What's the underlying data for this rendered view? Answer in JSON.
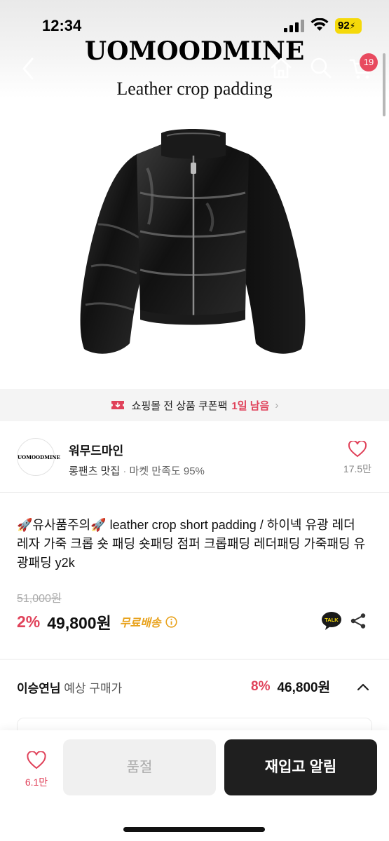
{
  "status_bar": {
    "time": "12:34",
    "battery": "92"
  },
  "brand": {
    "logo_text": "UOMOODMINE",
    "product_subtitle": "Leather crop padding"
  },
  "cart": {
    "badge_count": "19"
  },
  "icons": {
    "back": "chevron-left-icon",
    "home": "home-icon",
    "search": "search-icon",
    "cart": "cart-icon",
    "coupon": "ticket-icon",
    "heart": "heart-icon",
    "info": "info-icon",
    "talk": "kakaotalk-icon",
    "share": "share-icon",
    "expand": "chevron-up-icon"
  },
  "coupon_banner": {
    "text": "쇼핑몰 전 상품 쿠폰팩",
    "remaining": "1일 남음"
  },
  "shop": {
    "avatar_text": "UOMOODMINE",
    "name": "워무드마인",
    "tag": "롱팬츠 맛집",
    "separator": "·",
    "satisfaction": "마켓 만족도 95%",
    "likes": "17.5만"
  },
  "product": {
    "title": "🚀유사품주의🚀 leather crop short padding / 하이넥 유광 레더 레자 가죽 크롭 숏 패딩 숏패딩 점퍼 크롭패딩 레더패딩 가죽패딩 유광패딩 y2k",
    "original_price": "51,000원",
    "discount": "2%",
    "price": "49,800원",
    "shipping": "무료배송"
  },
  "expected_price": {
    "user": "이승연님",
    "label": "예상 구매가",
    "discount": "8%",
    "price": "46,800원"
  },
  "bottom_bar": {
    "likes": "6.1만",
    "soldout_label": "품절",
    "restock_label": "재입고 알림"
  },
  "colors": {
    "accent_red": "#e0425a",
    "badge_red": "#e84a5f",
    "shipping_orange": "#e8a21c",
    "button_dark": "#1f1f1f",
    "battery_yellow": "#f5d90a"
  }
}
